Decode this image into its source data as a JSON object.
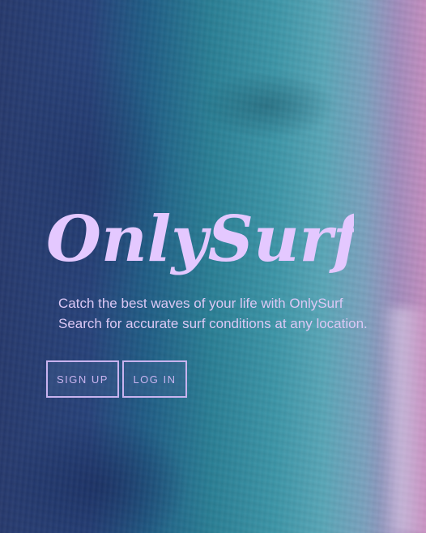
{
  "hero": {
    "brand": "OnlySurf",
    "tagline_line1": "Catch the best waves of your life with OnlySurf",
    "tagline_line2": "Search for accurate surf conditions at any location."
  },
  "actions": {
    "signup_label": "SIGN UP",
    "login_label": "LOG IN"
  },
  "colors": {
    "brand_text": "#e4c8ff",
    "button_border": "#c9b3ef",
    "tagline_text": "#dcc8f5"
  },
  "background": {
    "image": "aerial-ocean-photo"
  }
}
